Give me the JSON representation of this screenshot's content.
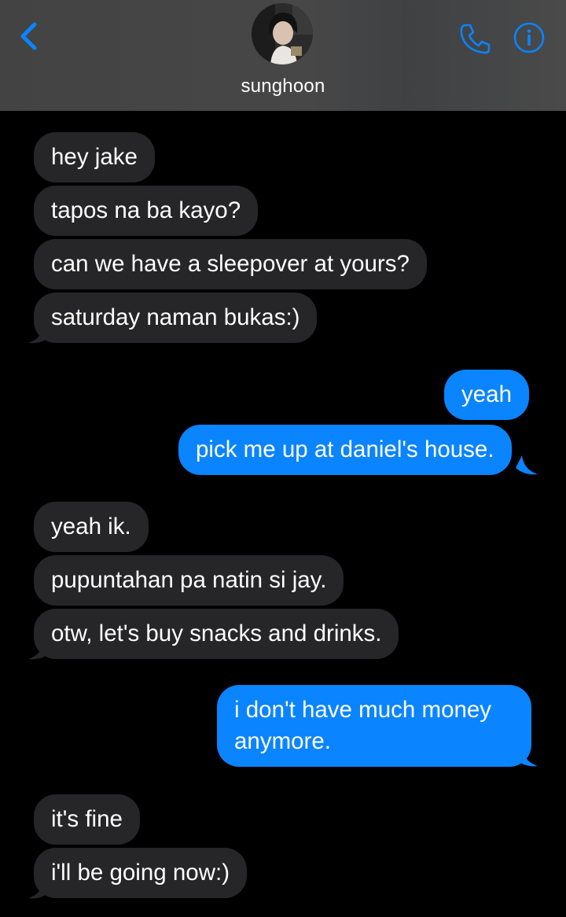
{
  "header": {
    "contact_name": "sunghoon",
    "back_icon": "chevron-left-icon",
    "call_icon": "phone-icon",
    "info_icon": "info-icon",
    "accent_color": "#0a84ff"
  },
  "messages": [
    {
      "sender": "contact",
      "text": "hey jake"
    },
    {
      "sender": "contact",
      "text": "tapos na ba kayo?"
    },
    {
      "sender": "contact",
      "text": "can we have a sleepover at yours?"
    },
    {
      "sender": "contact",
      "text": "saturday naman bukas:)"
    },
    {
      "sender": "me",
      "text": "yeah"
    },
    {
      "sender": "me",
      "text": "pick me up at daniel's house."
    },
    {
      "sender": "contact",
      "text": "yeah ik."
    },
    {
      "sender": "contact",
      "text": "pupuntahan pa natin si jay."
    },
    {
      "sender": "contact",
      "text": "otw, let's buy snacks and drinks."
    },
    {
      "sender": "me",
      "text": "i don't have much money anymore."
    },
    {
      "sender": "contact",
      "text": "it's fine"
    },
    {
      "sender": "contact",
      "text": "i'll be going now:)"
    }
  ],
  "colors": {
    "incoming_bubble": "#262628",
    "outgoing_bubble": "#0a84ff",
    "background": "#000000",
    "header_background": "#454545"
  }
}
